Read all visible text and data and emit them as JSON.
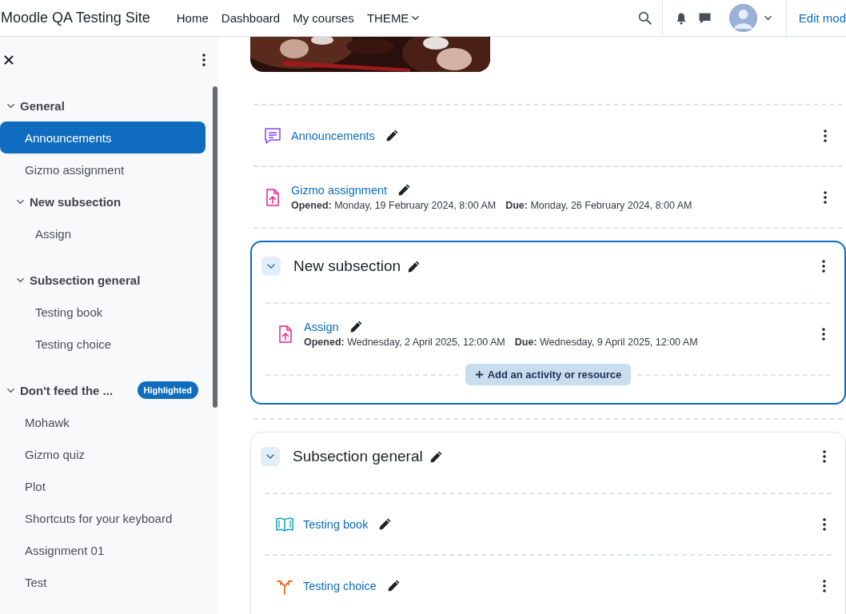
{
  "navbar": {
    "site_name": "Moodle QA Testing Site",
    "links": [
      {
        "label": "Home",
        "kind": "link"
      },
      {
        "label": "Dashboard",
        "kind": "link"
      },
      {
        "label": "My courses",
        "kind": "link"
      },
      {
        "label": "THEME",
        "kind": "dropdown"
      }
    ],
    "edit_mode": "Edit mod"
  },
  "course_index": {
    "sections": [
      {
        "label": "General",
        "expanded": true,
        "items": [
          {
            "kind": "activity",
            "label": "Announcements",
            "selected": true
          },
          {
            "kind": "activity",
            "label": "Gizmo assignment",
            "selected": false
          },
          {
            "kind": "subsection",
            "label": "New subsection",
            "expanded": true,
            "items": [
              {
                "kind": "activity",
                "label": "Assign",
                "selected": false
              }
            ]
          },
          {
            "kind": "subsection",
            "label": "Subsection general",
            "expanded": true,
            "items": [
              {
                "kind": "activity",
                "label": "Testing book",
                "selected": false
              },
              {
                "kind": "activity",
                "label": "Testing choice",
                "selected": false
              }
            ]
          }
        ]
      },
      {
        "label": "Don't feed the ...",
        "expanded": true,
        "badge": "Highlighted",
        "items": [
          {
            "kind": "activity",
            "label": "Mohawk",
            "selected": false
          },
          {
            "kind": "activity",
            "label": "Gizmo quiz",
            "selected": false
          },
          {
            "kind": "activity",
            "label": "Plot",
            "selected": false
          },
          {
            "kind": "activity",
            "label": "Shortcuts for your keyboard",
            "selected": false
          },
          {
            "kind": "activity",
            "label": "Assignment 01",
            "selected": false
          },
          {
            "kind": "activity",
            "label": "Test",
            "selected": false
          }
        ]
      }
    ]
  },
  "course": {
    "items": [
      {
        "kind": "forum",
        "label": "Announcements"
      },
      {
        "kind": "assign",
        "label": "Gizmo assignment",
        "dates": [
          "**Opened:** Monday, 19 February 2024, 8:00 AM",
          "**Due:** Monday, 26 February 2024, 8:00 AM"
        ]
      },
      {
        "kind": "subsection",
        "title": "New subsection",
        "highlighted": true,
        "expanded": true,
        "add_button": "Add an activity or resource",
        "items": [
          {
            "kind": "assign",
            "label": "Assign",
            "dates": [
              "**Opened:** Wednesday, 2 April 2025, 12:00 AM",
              "**Due:** Wednesday, 9 April 2025, 12:00 AM"
            ]
          }
        ]
      },
      {
        "kind": "subsection",
        "title": "Subsection general",
        "highlighted": false,
        "expanded": true,
        "items": [
          {
            "kind": "book",
            "label": "Testing book"
          },
          {
            "kind": "choice",
            "label": "Testing choice"
          }
        ]
      }
    ]
  }
}
